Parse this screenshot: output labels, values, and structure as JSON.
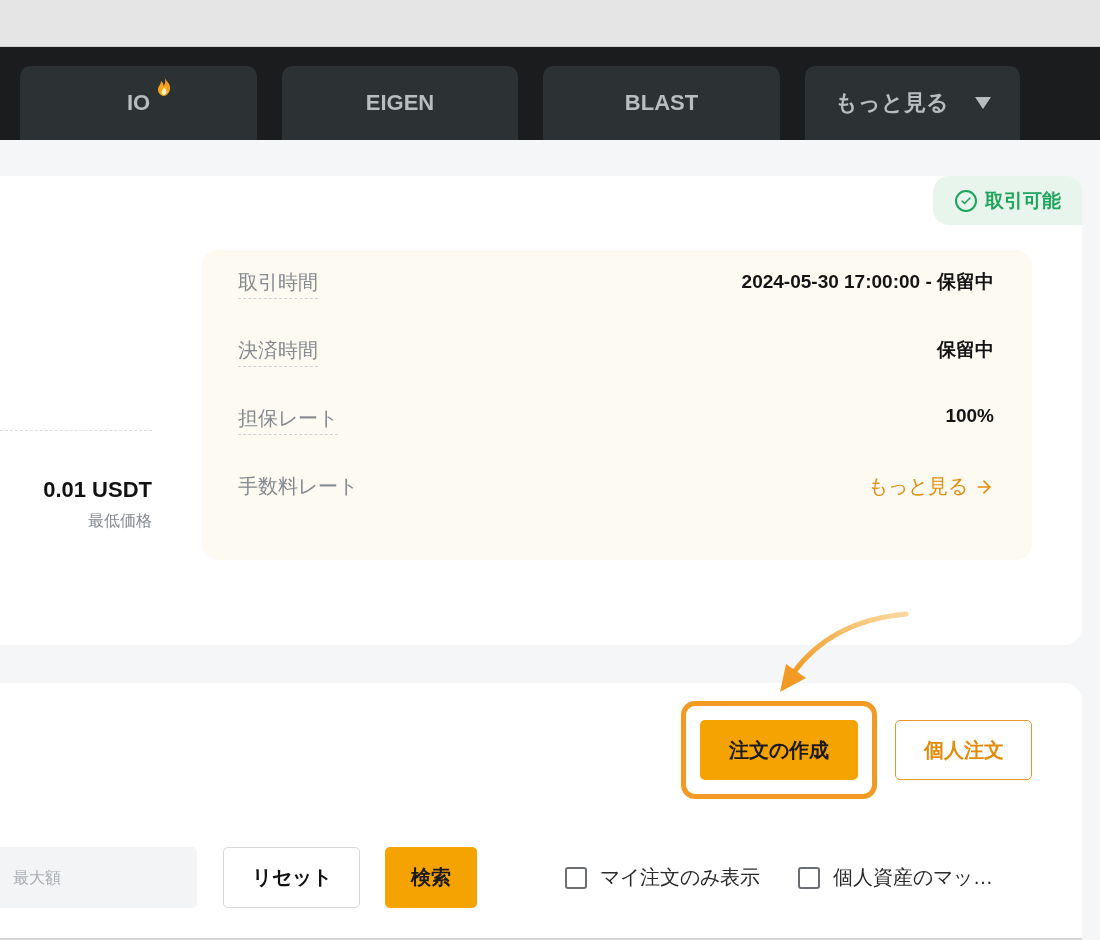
{
  "tabs": [
    {
      "label": "IO",
      "hot": true,
      "kind": "tab"
    },
    {
      "label": "EIGEN",
      "hot": false,
      "kind": "tab"
    },
    {
      "label": "BLAST",
      "hot": false,
      "kind": "tab"
    },
    {
      "label": "もっと見る",
      "hot": false,
      "kind": "dropdown"
    }
  ],
  "status": {
    "label": "取引可能"
  },
  "price": {
    "value": "0.01 USDT",
    "label": "最低価格"
  },
  "details": [
    {
      "label": "取引時間",
      "hint": true,
      "value": "2024-05-30 17:00:00 - 保留中",
      "kind": "text"
    },
    {
      "label": "決済時間",
      "hint": true,
      "value": "保留中",
      "kind": "text"
    },
    {
      "label": "担保レート",
      "hint": true,
      "value": "100%",
      "kind": "text"
    },
    {
      "label": "手数料レート",
      "hint": false,
      "value": "もっと見る",
      "kind": "link"
    }
  ],
  "actions": {
    "create": "注文の作成",
    "highlighted": true,
    "personal": "個人注文"
  },
  "filters": {
    "max_placeholder": "最大額",
    "reset": "リセット",
    "search": "検索",
    "checks": [
      {
        "label": "マイ注文のみ表示",
        "checked": false
      },
      {
        "label": "個人資産のマッ…",
        "checked": false
      }
    ]
  }
}
